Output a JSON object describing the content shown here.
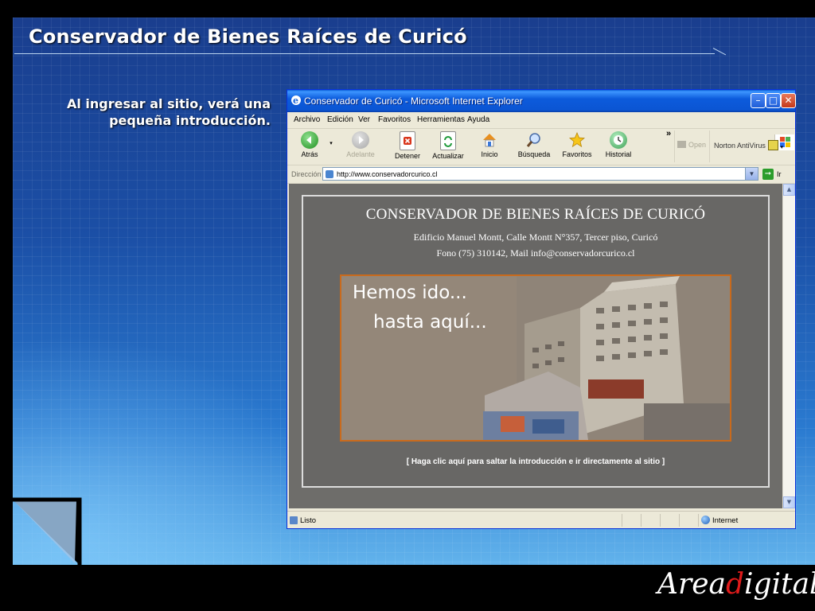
{
  "slide": {
    "title": "Conservador de Bienes Raíces de Curicó",
    "caption": "Al ingresar al sitio, verá una pequeña introducción.",
    "logo_part1": "Area",
    "logo_accent": "d",
    "logo_part2": "igital",
    "accent_color": "#e01b1b"
  },
  "browser": {
    "window_title": "Conservador de Curicó - Microsoft Internet Explorer",
    "menu": [
      "Archivo",
      "Edición",
      "Ver",
      "Favoritos",
      "Herramientas",
      "Ayuda"
    ],
    "toolbar": {
      "back": "Atrás",
      "forward": "Adelante",
      "stop": "Detener",
      "refresh": "Actualizar",
      "home": "Inicio",
      "search": "Búsqueda",
      "favorites": "Favoritos",
      "history": "Historial",
      "more": "»",
      "open": "Open",
      "antivirus": "Norton AntiVirus"
    },
    "address_label": "Dirección",
    "address_value": "http://www.conservadorcurico.cl",
    "go_label": "Ir",
    "status_left": "Listo",
    "status_zone": "Internet",
    "icons": {
      "back": "back-arrow-icon",
      "forward": "forward-arrow-icon",
      "stop": "stop-icon",
      "refresh": "refresh-icon",
      "home": "home-icon",
      "search": "search-icon",
      "favorites": "star-icon",
      "history": "history-icon"
    }
  },
  "page": {
    "heading": "CONSERVADOR DE BIENES RAÍCES DE CURICÓ",
    "address_line": "Edificio Manuel Montt, Calle Montt N°357, Tercer piso, Curicó",
    "contact_line": "Fono (75) 310142, Mail info@conservadorcurico.cl",
    "banner_line1": "Hemos ido...",
    "banner_line2": "hasta aquí...",
    "skip_link": "[ Haga clic aquí para saltar la introducción e ir directamente al sitio ]"
  }
}
